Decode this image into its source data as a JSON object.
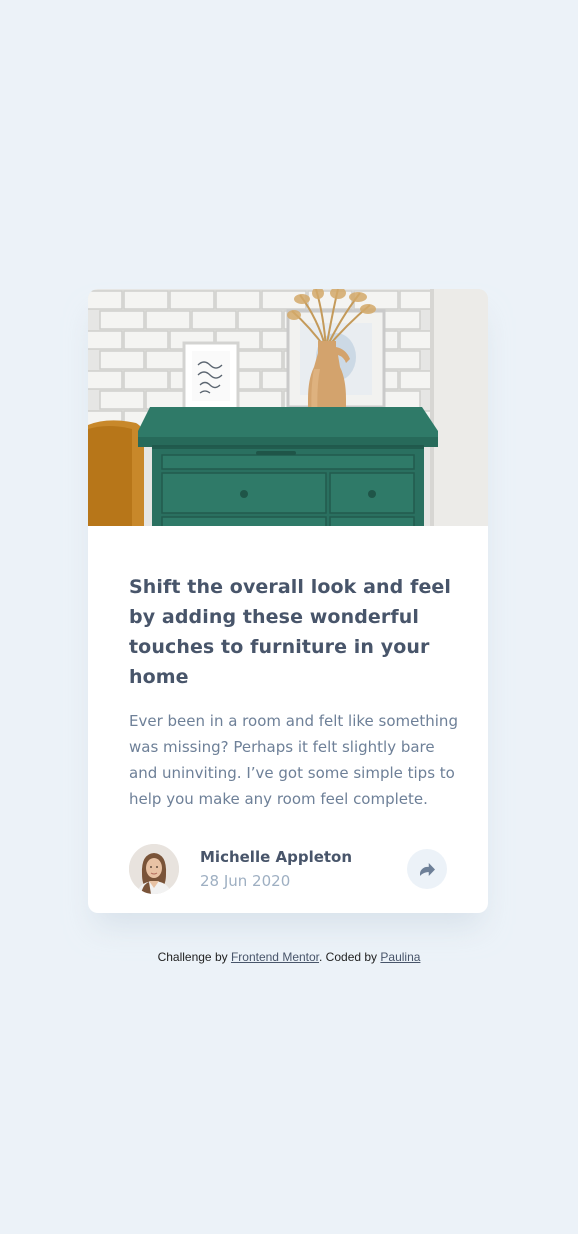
{
  "colors": {
    "page_background": "#ecf2f8",
    "card_background": "#ffffff",
    "title_text": "#48556a",
    "body_text": "#6e8098",
    "muted_text": "#9eafc2",
    "share_button_bg": "#ecf2f8",
    "share_icon": "#6e8098"
  },
  "card": {
    "image_icon": "drawers-photo",
    "title": "Shift the overall look and feel by adding these wonderful touches to furniture in your home",
    "description": "Ever been in a room and felt like something was missing? Perhaps it felt slightly bare and uninviting. I’ve got some simple tips to help you make any room feel complete.",
    "author": {
      "avatar_icon": "avatar-michelle",
      "name": "Michelle Appleton",
      "date": "28 Jun 2020"
    },
    "share_icon": "share-arrow-icon"
  },
  "attribution": {
    "prefix": "Challenge by ",
    "link1": "Frontend Mentor",
    "middle": ". Coded by ",
    "link2": "Paulina"
  }
}
